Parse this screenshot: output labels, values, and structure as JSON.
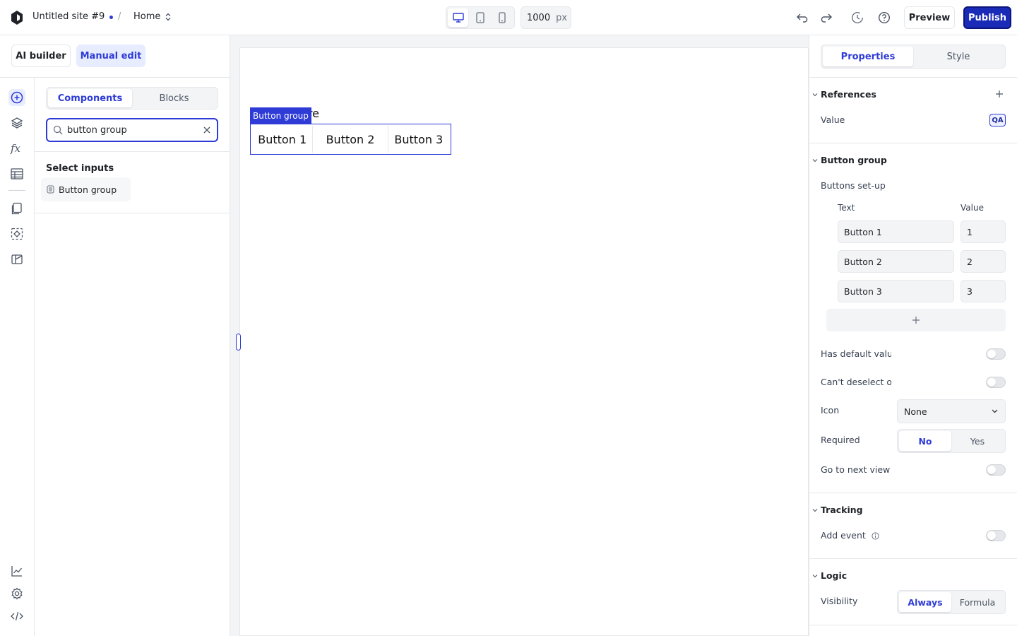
{
  "topbar": {
    "site_name": "Untitled site #9",
    "separator": "/",
    "page": "Home",
    "width_value": "1000",
    "width_unit": "px",
    "preview_label": "Preview",
    "publish_label": "Publish"
  },
  "modes": {
    "ai_builder": "AI builder",
    "manual_edit": "Manual edit"
  },
  "panel": {
    "tab_components": "Components",
    "tab_blocks": "Blocks",
    "search_value": "button group",
    "section_title": "Select inputs",
    "result_item": "Button group"
  },
  "canvas": {
    "heading_visible": "ere",
    "selection_label": "Button group",
    "buttons": [
      "Button 1",
      "Button 2",
      "Button 3"
    ]
  },
  "rpanel": {
    "tab_properties": "Properties",
    "tab_style": "Style",
    "references_title": "References",
    "value_label": "Value",
    "qa_badge": "QA",
    "button_group_title": "Button group",
    "buttons_setup": "Buttons set-up",
    "col_text": "Text",
    "col_value": "Value",
    "rows": [
      {
        "text": "Button 1",
        "value": "1"
      },
      {
        "text": "Button 2",
        "value": "2"
      },
      {
        "text": "Button 3",
        "value": "3"
      }
    ],
    "has_default": "Has default value",
    "cant_deselect": "Can't deselect option",
    "icon_label": "Icon",
    "icon_value": "None",
    "required_label": "Required",
    "required_no": "No",
    "required_yes": "Yes",
    "go_next": "Go to next view when selected",
    "tracking_title": "Tracking",
    "add_event": "Add event",
    "logic_title": "Logic",
    "visibility_label": "Visibility",
    "vis_always": "Always",
    "vis_formula": "Formula"
  },
  "colors": {
    "accent": "#2e3bd6",
    "publish": "#1a2bb8"
  }
}
